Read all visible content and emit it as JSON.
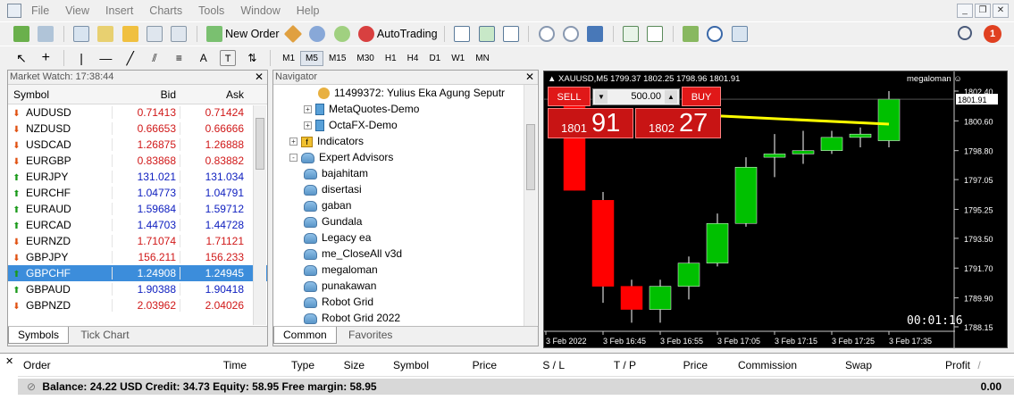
{
  "menu": [
    "File",
    "View",
    "Insert",
    "Charts",
    "Tools",
    "Window",
    "Help"
  ],
  "toolbar": {
    "new_order": "New Order",
    "autotrading": "AutoTrading",
    "timeframes": [
      "M1",
      "M5",
      "M15",
      "M30",
      "H1",
      "H4",
      "D1",
      "W1",
      "MN"
    ],
    "active_timeframe": "M5",
    "notification_count": "1"
  },
  "market_watch": {
    "title": "Market Watch: 17:38:44",
    "columns": {
      "symbol": "Symbol",
      "bid": "Bid",
      "ask": "Ask"
    },
    "rows": [
      {
        "symbol": "AUDUSD",
        "bid": "0.71413",
        "ask": "0.71424",
        "dir": "down",
        "color": "red"
      },
      {
        "symbol": "NZDUSD",
        "bid": "0.66653",
        "ask": "0.66666",
        "dir": "down",
        "color": "red"
      },
      {
        "symbol": "USDCAD",
        "bid": "1.26875",
        "ask": "1.26888",
        "dir": "down",
        "color": "red"
      },
      {
        "symbol": "EURGBP",
        "bid": "0.83868",
        "ask": "0.83882",
        "dir": "down",
        "color": "red"
      },
      {
        "symbol": "EURJPY",
        "bid": "131.021",
        "ask": "131.034",
        "dir": "up",
        "color": "blue"
      },
      {
        "symbol": "EURCHF",
        "bid": "1.04773",
        "ask": "1.04791",
        "dir": "up",
        "color": "blue"
      },
      {
        "symbol": "EURAUD",
        "bid": "1.59684",
        "ask": "1.59712",
        "dir": "up",
        "color": "blue"
      },
      {
        "symbol": "EURCAD",
        "bid": "1.44703",
        "ask": "1.44728",
        "dir": "up",
        "color": "blue"
      },
      {
        "symbol": "EURNZD",
        "bid": "1.71074",
        "ask": "1.71121",
        "dir": "down",
        "color": "red"
      },
      {
        "symbol": "GBPJPY",
        "bid": "156.211",
        "ask": "156.233",
        "dir": "down",
        "color": "red"
      },
      {
        "symbol": "GBPCHF",
        "bid": "1.24908",
        "ask": "1.24945",
        "dir": "up",
        "color": "blue",
        "selected": true
      },
      {
        "symbol": "GBPAUD",
        "bid": "1.90388",
        "ask": "1.90418",
        "dir": "up",
        "color": "blue"
      },
      {
        "symbol": "GBPNZD",
        "bid": "2.03962",
        "ask": "2.04026",
        "dir": "down",
        "color": "red"
      }
    ],
    "tabs": [
      "Symbols",
      "Tick Chart"
    ]
  },
  "navigator": {
    "title": "Navigator",
    "items": [
      {
        "label": "11499372: Yulius Eka Agung  Seputr",
        "type": "account",
        "indent": 3
      },
      {
        "label": "MetaQuotes-Demo",
        "type": "broker",
        "indent": 2,
        "expander": "+"
      },
      {
        "label": "OctaFX-Demo",
        "type": "broker",
        "indent": 2,
        "expander": "+"
      },
      {
        "label": "Indicators",
        "type": "folder",
        "indent": 1,
        "expander": "+"
      },
      {
        "label": "Expert Advisors",
        "type": "ea-folder",
        "indent": 1,
        "expander": "-"
      },
      {
        "label": "bajahitam",
        "type": "ea",
        "indent": 2
      },
      {
        "label": "disertasi",
        "type": "ea",
        "indent": 2
      },
      {
        "label": "gaban",
        "type": "ea",
        "indent": 2
      },
      {
        "label": "Gundala",
        "type": "ea",
        "indent": 2
      },
      {
        "label": "Legacy ea",
        "type": "ea",
        "indent": 2
      },
      {
        "label": "me_CloseAll v3d",
        "type": "ea",
        "indent": 2
      },
      {
        "label": "megaloman",
        "type": "ea",
        "indent": 2
      },
      {
        "label": "punakawan",
        "type": "ea",
        "indent": 2
      },
      {
        "label": "Robot Grid",
        "type": "ea",
        "indent": 2
      },
      {
        "label": "Robot Grid 2022",
        "type": "ea",
        "indent": 2
      }
    ],
    "tabs": [
      "Common",
      "Favorites"
    ]
  },
  "chart": {
    "header": "XAUUSD,M5  1799.37 1802.25 1798.96 1801.91",
    "ea_name": "megaloman",
    "countdown": "00:01:16",
    "one_click": {
      "sell_label": "SELL",
      "buy_label": "BUY",
      "volume": "500.00",
      "sell_big": "1801",
      "sell_small": "91",
      "buy_big": "1802",
      "buy_small": "27"
    },
    "current_price": "1801.91",
    "price_ticks": [
      "1802.40",
      "1800.60",
      "1798.80",
      "1797.05",
      "1795.25",
      "1793.50",
      "1791.70",
      "1789.90",
      "1788.15"
    ],
    "time_ticks": [
      "3 Feb 2022",
      "3 Feb 16:45",
      "3 Feb 16:55",
      "3 Feb 17:05",
      "3 Feb 17:15",
      "3 Feb 17:25",
      "3 Feb 17:35"
    ],
    "colors": {
      "bull": "#00c000",
      "bear": "#ff0000",
      "ma": "#ffff00",
      "bg": "#000000"
    }
  },
  "chart_data": {
    "type": "candlestick",
    "title": "XAUUSD,M5",
    "ylim": [
      1788.15,
      1802.4
    ],
    "candles": [
      {
        "o": 1802.4,
        "h": 1802.4,
        "l": 1796.4,
        "c": 1796.4
      },
      {
        "o": 1795.8,
        "h": 1796.3,
        "l": 1789.6,
        "c": 1790.6
      },
      {
        "o": 1790.6,
        "h": 1791.0,
        "l": 1788.4,
        "c": 1789.2
      },
      {
        "o": 1789.2,
        "h": 1791.0,
        "l": 1788.4,
        "c": 1790.6
      },
      {
        "o": 1790.6,
        "h": 1792.4,
        "l": 1789.8,
        "c": 1792.0
      },
      {
        "o": 1792.0,
        "h": 1795.0,
        "l": 1791.8,
        "c": 1794.4
      },
      {
        "o": 1794.4,
        "h": 1798.4,
        "l": 1794.2,
        "c": 1797.8
      },
      {
        "o": 1798.4,
        "h": 1799.8,
        "l": 1797.2,
        "c": 1798.6
      },
      {
        "o": 1798.6,
        "h": 1800.0,
        "l": 1798.0,
        "c": 1798.8
      },
      {
        "o": 1798.8,
        "h": 1800.0,
        "l": 1798.6,
        "c": 1799.6
      },
      {
        "o": 1799.6,
        "h": 1800.2,
        "l": 1799.0,
        "c": 1799.8
      },
      {
        "o": 1799.4,
        "h": 1802.4,
        "l": 1799.0,
        "c": 1801.91
      }
    ]
  },
  "terminal": {
    "columns": [
      "Order",
      "Time",
      "Type",
      "Size",
      "Symbol",
      "Price",
      "S / L",
      "T / P",
      "Price",
      "Commission",
      "Swap",
      "Profit"
    ],
    "balance_line": "Balance: 24.22 USD  Credit: 34.73  Equity: 58.95  Free margin: 58.95",
    "profit_total": "0.00"
  }
}
